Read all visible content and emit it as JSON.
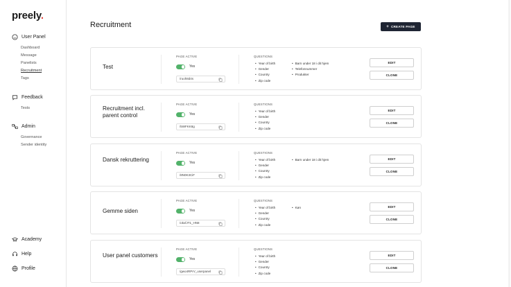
{
  "brand": {
    "name": "preely",
    "dot": "."
  },
  "sidebar": {
    "sections": [
      {
        "label": "User Panel",
        "icon": "smiley-icon",
        "items": [
          "Dashboard",
          "Message",
          "Panelists",
          "Recruitment",
          "Tags"
        ]
      },
      {
        "label": "Feedback",
        "icon": "chat-bubble-icon",
        "items": [
          "Tests"
        ]
      },
      {
        "label": "Admin",
        "icon": "flow-icon",
        "items": [
          "Governance",
          "Sender identity"
        ]
      }
    ],
    "active_item": "Recruitment",
    "bottom": [
      {
        "label": "Academy",
        "icon": "graduation-cap-icon"
      },
      {
        "label": "Help",
        "icon": "headset-icon"
      },
      {
        "label": "Profile",
        "icon": "globe-icon"
      }
    ]
  },
  "main": {
    "title": "Recruitment",
    "create_button": {
      "label": "CREATE PAGE",
      "plus": "+"
    },
    "page_active_label": "PAGE ACTIVE",
    "questions_label": "QUESTIONS",
    "yes_label": "Yes",
    "edit_label": "EDIT",
    "clone_label": "CLONE",
    "accent_color": "#52b26a",
    "cards": [
      {
        "name": "Test",
        "slug": "/ruoh8d4s",
        "active": true,
        "questions_col1": [
          "Year of birth",
          "Gender",
          "Country",
          "Zip code"
        ],
        "questions_col2": [
          "Barn under 18 i dit hjem",
          "Telefonnummer",
          "Produkter"
        ]
      },
      {
        "name": "Recruitment incl. parent control",
        "slug": "/5WFKK8g",
        "active": true,
        "questions_col1": [
          "Year of birth",
          "Gender",
          "Country",
          "Zip code"
        ],
        "questions_col2": []
      },
      {
        "name": "Dansk rekruttering",
        "slug": "/8N0K3CiF",
        "active": true,
        "questions_col1": [
          "Year of birth",
          "Gender",
          "Country",
          "Zip code"
        ],
        "questions_col2": [
          "Barn under 18 i dit hjem"
        ]
      },
      {
        "name": "Gemme siden",
        "slug": "/okxfJT1_HN8",
        "active": true,
        "questions_col1": [
          "Year of birth",
          "Gender",
          "Country",
          "Zip code"
        ],
        "questions_col2": [
          "Køn"
        ]
      },
      {
        "name": "User panel customers",
        "slug": "/gwo4RPrV_userpanel",
        "active": true,
        "questions_col1": [
          "Year of birth",
          "Gender",
          "Country",
          "Zip code"
        ],
        "questions_col2": []
      }
    ]
  }
}
